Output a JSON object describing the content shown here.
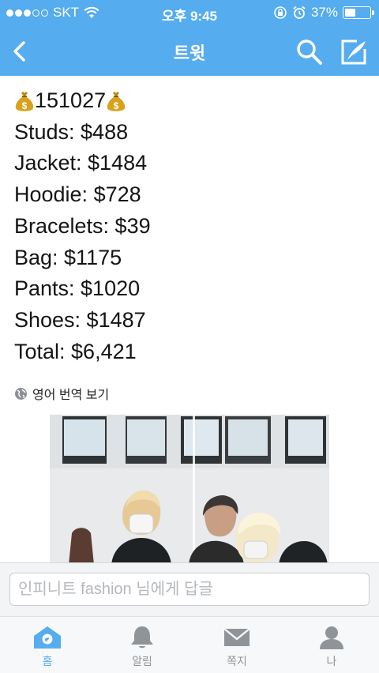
{
  "status_bar": {
    "carrier": "SKT",
    "time": "오후 9:45",
    "battery_percent": "37%",
    "battery_level": 0.37
  },
  "nav": {
    "title": "트윗",
    "icons": [
      "back-chevron-icon",
      "search-icon",
      "compose-icon"
    ]
  },
  "tweet": {
    "first_line_text": "151027",
    "lines": [
      "Studs: $488",
      "Jacket: $1484",
      "Hoodie: $728",
      "Bracelets: $39",
      "Bag: $1175",
      "Pants: $1020",
      "Shoes: $1487",
      "Total: $6,421"
    ],
    "translate_label": "영어 번역 보기"
  },
  "reply": {
    "placeholder": "인피니트 fashion 님에게 답글"
  },
  "tabs": [
    {
      "label": "홈",
      "icon": "home-icon",
      "active": true
    },
    {
      "label": "알림",
      "icon": "bell-icon",
      "active": false
    },
    {
      "label": "쪽지",
      "icon": "envelope-icon",
      "active": false
    },
    {
      "label": "나",
      "icon": "person-icon",
      "active": false
    }
  ],
  "colors": {
    "accent": "#55acee",
    "tab_inactive": "#8f9499"
  }
}
